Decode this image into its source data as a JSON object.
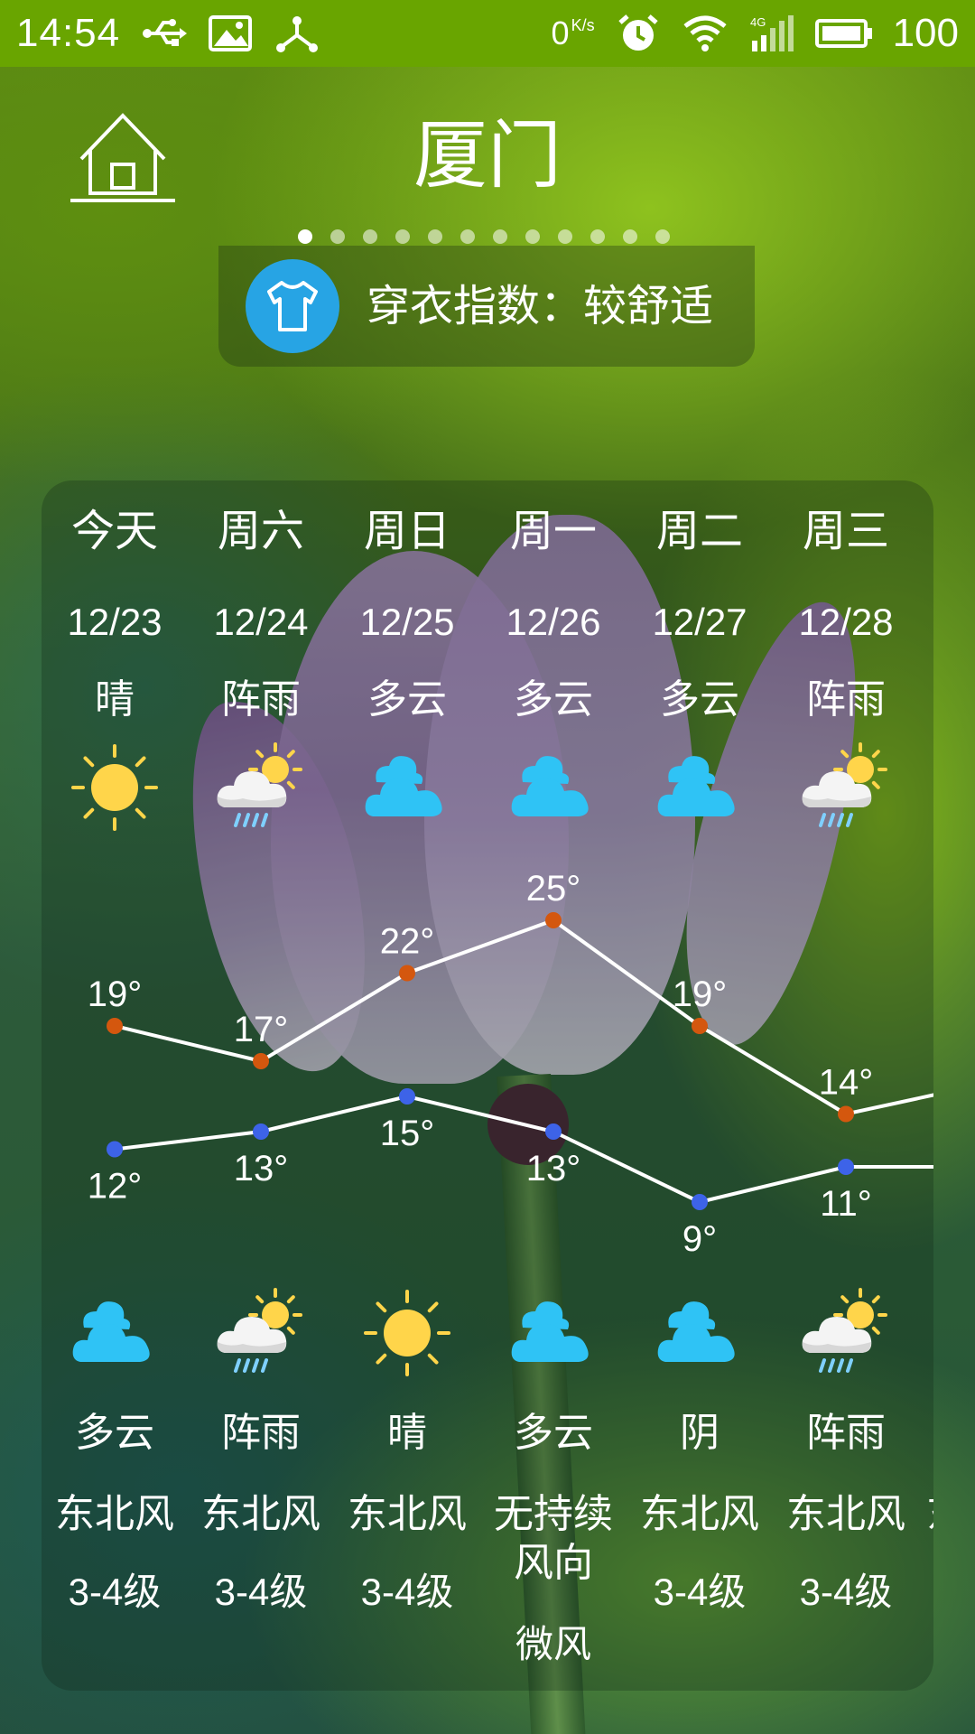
{
  "status_bar": {
    "time": "14:54",
    "net_speed": "0",
    "net_speed_unit": "K/s",
    "network": "4G",
    "battery": "100",
    "left_icons": [
      "usb-icon",
      "image-icon",
      "share-icon"
    ],
    "right_icons": [
      "alarm-icon",
      "wifi-icon",
      "signal-icon",
      "battery-icon"
    ],
    "color": "#69a500"
  },
  "header": {
    "city": "厦门",
    "page_count": 12,
    "active_page": 0
  },
  "dress_index": {
    "label": "穿衣指数：",
    "value": "较舒适",
    "icon": "shirt-icon",
    "icon_bg": "#27a4e4"
  },
  "forecast": {
    "days": [
      {
        "day": "今天",
        "date": "12/23",
        "day_weather": "晴",
        "day_icon": "sun-icon",
        "night_icon": "cloudy-icon",
        "night_weather": "多云",
        "wind_dir": "东北风",
        "wind_level": "3-4级",
        "high": 19,
        "low": 12
      },
      {
        "day": "周六",
        "date": "12/24",
        "day_weather": "阵雨",
        "day_icon": "shower-icon",
        "night_icon": "shower-icon",
        "night_weather": "阵雨",
        "wind_dir": "东北风",
        "wind_level": "3-4级",
        "high": 17,
        "low": 13
      },
      {
        "day": "周日",
        "date": "12/25",
        "day_weather": "多云",
        "day_icon": "cloudy-icon",
        "night_icon": "sun-icon",
        "night_weather": "晴",
        "wind_dir": "东北风",
        "wind_level": "3-4级",
        "high": 22,
        "low": 15
      },
      {
        "day": "周一",
        "date": "12/26",
        "day_weather": "多云",
        "day_icon": "cloudy-icon",
        "night_icon": "cloudy-icon",
        "night_weather": "多云",
        "wind_dir": "无持续风向",
        "wind_level": "微风",
        "high": 25,
        "low": 13
      },
      {
        "day": "周二",
        "date": "12/27",
        "day_weather": "多云",
        "day_icon": "cloudy-icon",
        "night_icon": "cloudy-icon",
        "night_weather": "阴",
        "wind_dir": "东北风",
        "wind_level": "3-4级",
        "high": 19,
        "low": 9
      },
      {
        "day": "周三",
        "date": "12/28",
        "day_weather": "阵雨",
        "day_icon": "shower-icon",
        "night_icon": "shower-icon",
        "night_weather": "阵雨",
        "wind_dir": "东北风",
        "wind_level": "3-4级",
        "high": 14,
        "low": 11
      }
    ],
    "partial_next_wind": "东",
    "colors": {
      "high_dot": "#d4570e",
      "low_dot": "#3d63e8",
      "line": "#ffffff",
      "sun": "#ffd54a",
      "cloud": "#2fc3f5"
    }
  }
}
